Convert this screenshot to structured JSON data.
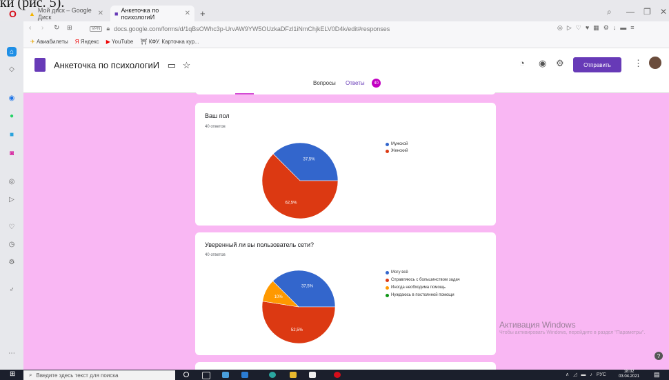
{
  "doc_fragment": "ки (рис. 5).",
  "browser": {
    "tabs": [
      {
        "label": "Мой диск – Google Диск",
        "active": false
      },
      {
        "label": "Анкеточка по психологиИ",
        "active": true
      }
    ],
    "new_tab": "+",
    "url": "docs.google.com/forms/d/1qBsOWhc3p-UrvAW9YW5OUzkaDFzl1iNmChjkELV0D4k/edit#responses",
    "vpn_label": "VPN",
    "bookmarks": [
      "Авиабилеты",
      "Яндекс",
      "YouTube",
      "КФУ. Карточка кур..."
    ]
  },
  "form": {
    "title": "Анкеточка по психологиИ",
    "send_label": "Отправить",
    "tabs": {
      "questions": "Вопросы",
      "answers": "Ответы",
      "answers_count": "40"
    }
  },
  "questions": [
    {
      "title": "Ваш пол",
      "count": "40 ответов",
      "legend": [
        "Мужской",
        "Женский"
      ]
    },
    {
      "title": "Уверенный ли вы пользователь сети?",
      "count": "40 ответов",
      "legend": [
        "Могу всё",
        "Справляюсь с большинством задач",
        "Иногда необходима помощь",
        "Нуждаюсь в постоянной помощи"
      ]
    }
  ],
  "chart_data": [
    {
      "type": "pie",
      "categories": [
        "Мужской",
        "Женский"
      ],
      "values": [
        37.5,
        62.5
      ],
      "labels": [
        "37,5%",
        "62,5%"
      ],
      "colors": [
        "#3366cc",
        "#dc3912"
      ]
    },
    {
      "type": "pie",
      "categories": [
        "Могу всё",
        "Справляюсь с большинством задач",
        "Иногда необходима помощь",
        "Нуждаюсь в постоянной помощи"
      ],
      "values": [
        37.5,
        52.5,
        10,
        0
      ],
      "labels": [
        "37,5%",
        "52,5%",
        "10%",
        ""
      ],
      "colors": [
        "#3366cc",
        "#dc3912",
        "#ff9900",
        "#109618"
      ]
    }
  ],
  "activation": {
    "title": "Активация Windows",
    "sub": "Чтобы активировать Windows, перейдите в раздел \"Параметры\"."
  },
  "taskbar": {
    "search_placeholder": "Введите здесь текст для поиска",
    "lang": "РУС",
    "time": "18:02",
    "date": "03.04.2021"
  },
  "colors": {
    "pink_bg": "#f9b7f3",
    "forms_purple": "#673ab7"
  }
}
